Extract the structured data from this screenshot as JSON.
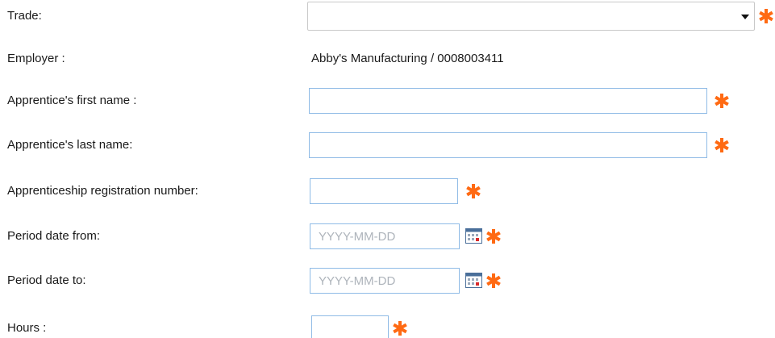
{
  "theme": {
    "required_color": "#ff6a13",
    "input_border": "#8fbbe6",
    "placeholder_color": "#aeb4bb"
  },
  "form": {
    "trade": {
      "label": "Trade:",
      "selected_value": "",
      "icon": "chevron-down-icon"
    },
    "employer": {
      "label": "Employer :",
      "value": "Abby's Manufacturing / 0008003411"
    },
    "first_name": {
      "label": "Apprentice's first name :",
      "value": ""
    },
    "last_name": {
      "label": "Apprentice's last name:",
      "value": ""
    },
    "registration_number": {
      "label": "Apprenticeship registration number:",
      "value": ""
    },
    "date_from": {
      "label": "Period date from:",
      "placeholder": "YYYY-MM-DD",
      "icon": "calendar-icon"
    },
    "date_to": {
      "label": "Period date to:",
      "placeholder": "YYYY-MM-DD",
      "icon": "calendar-icon"
    },
    "hours": {
      "label": "Hours :",
      "value": ""
    },
    "required_icon": "asterisk-icon"
  }
}
